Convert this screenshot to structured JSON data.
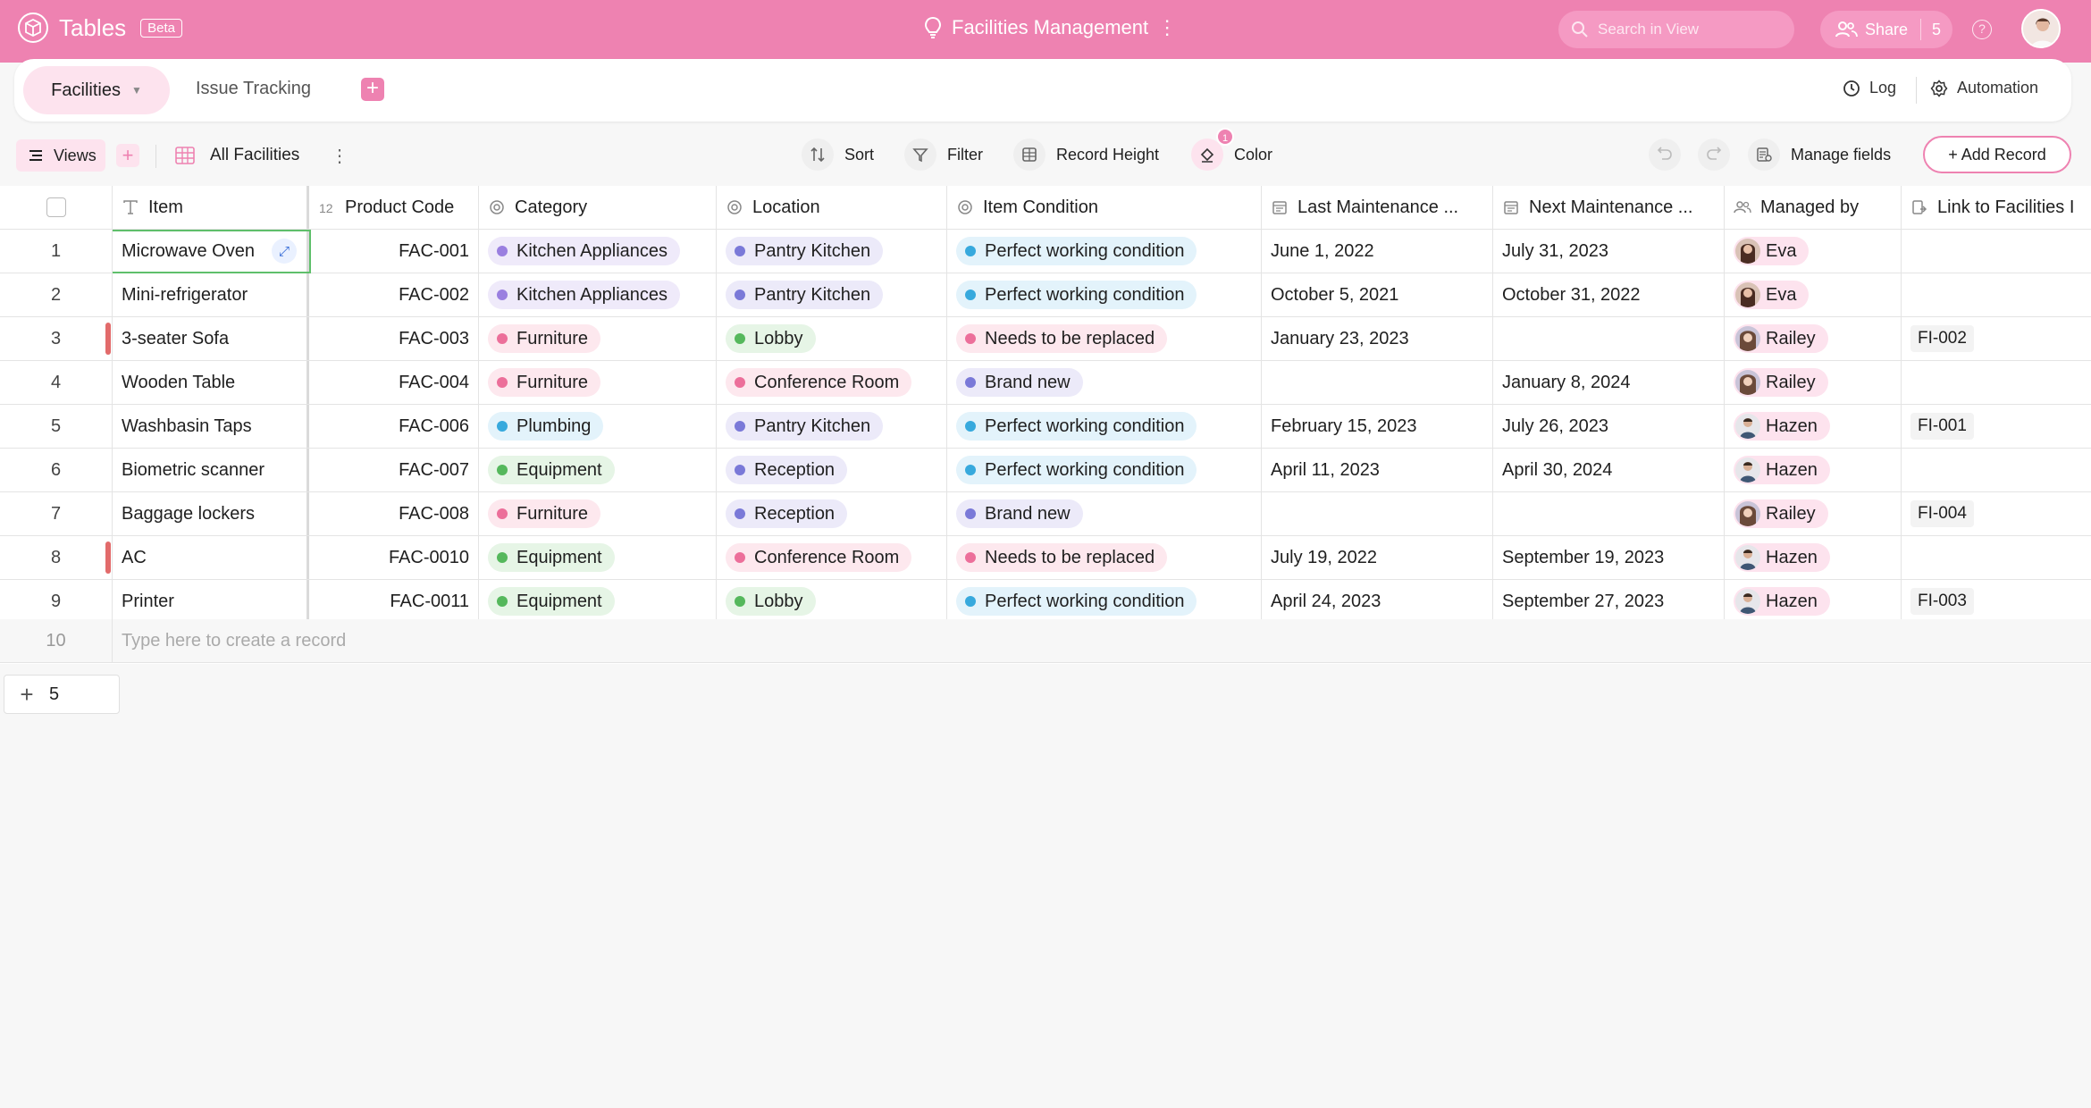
{
  "app": {
    "name": "Tables",
    "badge": "Beta"
  },
  "title": "Facilities Management",
  "search": {
    "placeholder": "Search in View"
  },
  "share": {
    "label": "Share",
    "count": "5"
  },
  "help_glyph": "?",
  "tabs": {
    "active": "Facilities",
    "second": "Issue Tracking",
    "add": "+"
  },
  "right_actions": {
    "log": "Log",
    "automation": "Automation"
  },
  "toolbar": {
    "views": "Views",
    "view_name": "All Facilities",
    "sort": "Sort",
    "filter": "Filter",
    "record_height": "Record Height",
    "color": "Color",
    "color_badge": "1",
    "manage_fields": "Manage fields",
    "add_record": "+ Add Record"
  },
  "columns": [
    "Item",
    "Product Code",
    "Category",
    "Location",
    "Item Condition",
    "Last Maintenance ...",
    "Next Maintenance ...",
    "Managed by",
    "Link to Facilities I"
  ],
  "rows": [
    {
      "n": "1",
      "item": "Microwave Oven",
      "code": "FAC-001",
      "category": "Kitchen Appliances",
      "location": "Pantry Kitchen",
      "condition": "Perfect working condition",
      "last": "June 1, 2022",
      "next": "July 31, 2023",
      "manager": "Eva",
      "link": ""
    },
    {
      "n": "2",
      "item": "Mini-refrigerator",
      "code": "FAC-002",
      "category": "Kitchen Appliances",
      "location": "Pantry Kitchen",
      "condition": "Perfect working condition",
      "last": "October 5, 2021",
      "next": "October 31, 2022",
      "manager": "Eva",
      "link": ""
    },
    {
      "n": "3",
      "item": "3-seater Sofa",
      "code": "FAC-003",
      "category": "Furniture",
      "location": "Lobby",
      "condition": "Needs to be replaced",
      "last": "January 23, 2023",
      "next": "",
      "manager": "Railey",
      "link": "FI-002"
    },
    {
      "n": "4",
      "item": "Wooden Table",
      "code": "FAC-004",
      "category": "Furniture",
      "location": "Conference Room",
      "condition": "Brand new",
      "last": "",
      "next": "January 8, 2024",
      "manager": "Railey",
      "link": ""
    },
    {
      "n": "5",
      "item": "Washbasin Taps",
      "code": "FAC-006",
      "category": "Plumbing",
      "location": "Pantry Kitchen",
      "condition": "Perfect working condition",
      "last": "February 15, 2023",
      "next": "July 26, 2023",
      "manager": "Hazen",
      "link": "FI-001"
    },
    {
      "n": "6",
      "item": "Biometric scanner",
      "code": "FAC-007",
      "category": "Equipment",
      "location": "Reception",
      "condition": "Perfect working condition",
      "last": "April 11, 2023",
      "next": "April 30, 2024",
      "manager": "Hazen",
      "link": ""
    },
    {
      "n": "7",
      "item": "Baggage lockers",
      "code": "FAC-008",
      "category": "Furniture",
      "location": "Reception",
      "condition": "Brand new",
      "last": "",
      "next": "",
      "manager": "Railey",
      "link": "FI-004"
    },
    {
      "n": "8",
      "item": "AC",
      "code": "FAC-0010",
      "category": "Equipment",
      "location": "Conference Room",
      "condition": "Needs to be replaced",
      "last": "July 19, 2022",
      "next": "September 19, 2023",
      "manager": "Hazen",
      "link": ""
    },
    {
      "n": "9",
      "item": "Printer",
      "code": "FAC-0011",
      "category": "Equipment",
      "location": "Lobby",
      "condition": "Perfect working condition",
      "last": "April 24, 2023",
      "next": "September 27, 2023",
      "manager": "Hazen",
      "link": "FI-003"
    }
  ],
  "new_row": {
    "n": "10",
    "placeholder": "Type here to create a record"
  },
  "footer": {
    "plus": "+",
    "count": "5"
  },
  "colors": {
    "accent": "#ee82b1",
    "category": {
      "Kitchen Appliances": {
        "bg": "#efeafa",
        "dot": "#9a7fe0"
      },
      "Furniture": {
        "bg": "#fde8ee",
        "dot": "#ec6f9a"
      },
      "Plumbing": {
        "bg": "#e3f3fb",
        "dot": "#37a9dd"
      },
      "Equipment": {
        "bg": "#e6f5e6",
        "dot": "#55b85c"
      }
    },
    "location": {
      "Pantry Kitchen": {
        "bg": "#eceaf9",
        "dot": "#7a79d8"
      },
      "Lobby": {
        "bg": "#e6f5e6",
        "dot": "#55b85c"
      },
      "Conference Room": {
        "bg": "#fde8ee",
        "dot": "#ec6f9a"
      },
      "Reception": {
        "bg": "#eceaf9",
        "dot": "#7a79d8"
      }
    },
    "condition": {
      "Perfect working condition": {
        "bg": "#e3f3fb",
        "dot": "#37a9dd"
      },
      "Needs to be replaced": {
        "bg": "#fde8ee",
        "dot": "#ec6f9a"
      },
      "Brand new": {
        "bg": "#eceaf9",
        "dot": "#7a79d8"
      }
    },
    "flag": "#e26b6b"
  },
  "flagged_rows": [
    "3",
    "8"
  ],
  "icons": {
    "item": "text-field-icon",
    "code": "number-field-icon",
    "category": "single-select-icon",
    "location": "single-select-icon",
    "condition": "single-select-icon",
    "last": "date-field-icon",
    "next": "date-field-icon",
    "managed": "people-field-icon",
    "link": "link-field-icon"
  }
}
